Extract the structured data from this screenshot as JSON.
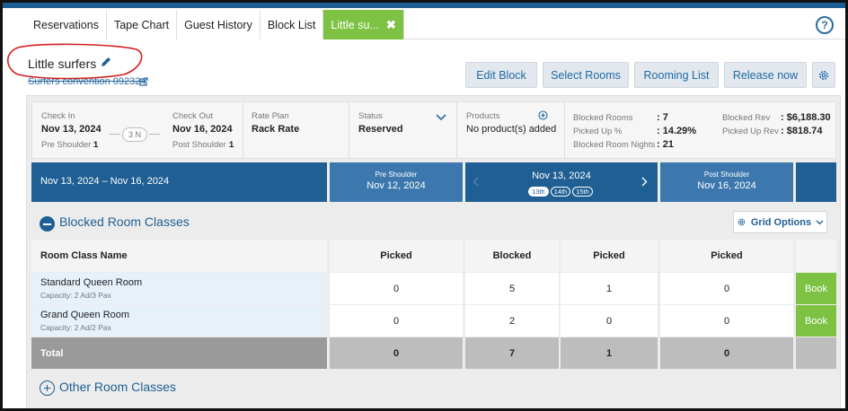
{
  "tabs": [
    {
      "label": "Reservations"
    },
    {
      "label": "Tape Chart"
    },
    {
      "label": "Guest History"
    },
    {
      "label": "Block List"
    },
    {
      "label": "Little su...",
      "close": "✖"
    }
  ],
  "help_label": "?",
  "block": {
    "name": "Little surfers",
    "link": "Surfers convention 092324"
  },
  "actions": {
    "edit_block": "Edit Block",
    "select_rooms": "Select Rooms",
    "rooming_list": "Rooming List",
    "release_now": "Release now"
  },
  "info": {
    "check_in_label": "Check In",
    "check_in": "Nov 13, 2024",
    "nights": "3 N",
    "check_out_label": "Check Out",
    "check_out": "Nov 16, 2024",
    "pre_shoulder_label": "Pre Shoulder :",
    "pre_shoulder": "1",
    "post_shoulder_label": "Post Shoulder :",
    "post_shoulder": "1",
    "rate_plan_label": "Rate Plan",
    "rate_plan": "Rack Rate",
    "status_label": "Status",
    "status": "Reserved",
    "products_label": "Products",
    "products": "No product(s) added",
    "blocked_rooms_label": "Blocked Rooms",
    "blocked_rooms": ": 7",
    "picked_up_pct_label": "Picked Up %",
    "picked_up_pct": ": 14.29%",
    "blocked_room_nights_label": "Blocked Room Nights",
    "blocked_room_nights": ": 21",
    "blocked_rev_label": "Blocked Rev",
    "blocked_rev": ": $6,188.30",
    "picked_up_rev_label": "Picked Up Rev",
    "picked_up_rev": ": $818.74"
  },
  "dates": {
    "range": "Nov 13, 2024 – Nov 16, 2024",
    "pre_shoulder_label": "Pre Shoulder",
    "pre_shoulder_date": "Nov 12, 2024",
    "current": "Nov 13, 2024",
    "days": [
      "13th",
      "14th",
      "15th"
    ],
    "post_shoulder_label": "Post Shoulder",
    "post_shoulder_date": "Nov 16, 2024"
  },
  "blocked_section": {
    "title": "Blocked Room Classes",
    "grid_options": "Grid Options"
  },
  "table": {
    "col_name": "Room Class Name",
    "col_pre_picked": "Picked",
    "col_blocked": "Blocked",
    "col_picked": "Picked",
    "col_post_picked": "Picked",
    "rows": [
      {
        "name": "Standard Queen Room",
        "capacity": "Capacity: 2 Ad/3 Pax",
        "pre_picked": "0",
        "blocked": "5",
        "picked": "1",
        "post_picked": "0",
        "book": "Book"
      },
      {
        "name": "Grand Queen Room",
        "capacity": "Capacity: 2 Ad/2 Pax",
        "pre_picked": "0",
        "blocked": "2",
        "picked": "0",
        "post_picked": "0",
        "book": "Book"
      }
    ],
    "total": {
      "label": "Total",
      "pre_picked": "0",
      "blocked": "7",
      "picked": "1",
      "post_picked": "0"
    }
  },
  "other_section": {
    "title": "Other Room Classes"
  },
  "colors": {
    "brand_blue": "#1f5f93",
    "accent_green": "#7dc242",
    "annotation_red": "#d42020"
  }
}
